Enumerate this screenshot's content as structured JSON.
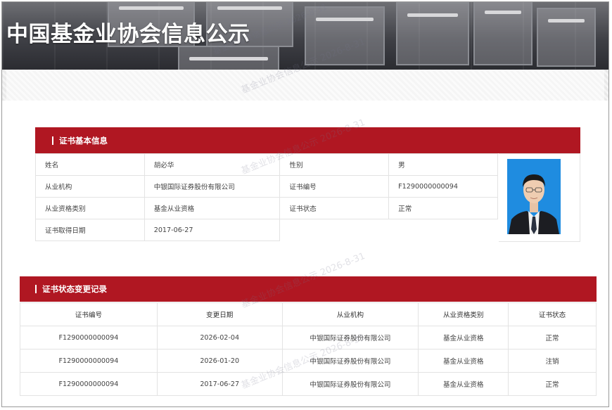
{
  "header": {
    "title": "中国基金业协会信息公示"
  },
  "watermark": "基金业协会信息公示 2026-8-31",
  "basic_info": {
    "section_title": "证书基本信息",
    "rows": [
      [
        "姓名",
        "胡必华",
        "性别",
        "男"
      ],
      [
        "从业机构",
        "中银国际证券股份有限公司",
        "证书编号",
        "F1290000000094"
      ],
      [
        "从业资格类别",
        "基金从业资格",
        "证书状态",
        "正常"
      ],
      [
        "证书取得日期",
        "2017-06-27"
      ]
    ]
  },
  "history": {
    "section_title": "证书状态变更记录",
    "columns": [
      "证书编号",
      "变更日期",
      "从业机构",
      "从业资格类别",
      "证书状态"
    ],
    "rows": [
      [
        "F1290000000094",
        "2026-02-04",
        "中银国际证券股份有限公司",
        "基金从业资格",
        "正常"
      ],
      [
        "F1290000000094",
        "2026-01-20",
        "中银国际证券股份有限公司",
        "基金从业资格",
        "注销"
      ],
      [
        "F1290000000094",
        "2017-06-27",
        "中银国际证券股份有限公司",
        "基金从业资格",
        "正常"
      ]
    ]
  },
  "colors": {
    "accent": "#b01722",
    "photo_bg": "#1f8ce0"
  }
}
